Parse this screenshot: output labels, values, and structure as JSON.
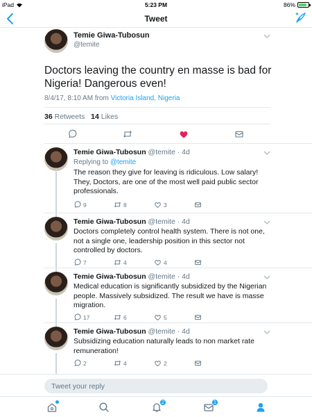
{
  "status_bar": {
    "device": "iPad",
    "time": "5:23 PM",
    "battery_percent": "86%",
    "battery_level": 0.86
  },
  "nav": {
    "title": "Tweet"
  },
  "main_tweet": {
    "name": "Temie Giwa-Tubosun",
    "handle": "@temite",
    "text": "Doctors leaving the country en masse is bad for Nigeria! Dangerous even!",
    "timestamp": "8/4/17, 8:10 AM from",
    "location": "Victoria Island, Nigeria",
    "retweets_count": "36",
    "retweets_label": "Retweets",
    "likes_count": "14",
    "likes_label": "Likes",
    "liked": true
  },
  "replies": [
    {
      "name": "Temie Giwa-Tubosun",
      "meta": "@temite · 4d",
      "replying_prefix": "Replying to",
      "replying_to": "@temite",
      "text": "The reason they give for leaving is ridiculous. Low salary! They, Doctors, are one of the most well paid public sector professionals.",
      "replies": "9",
      "retweets": "8",
      "likes": "3"
    },
    {
      "name": "Temie Giwa-Tubosun",
      "meta": "@temite · 4d",
      "text": "Doctors completely control health system. There is not one, not a single one, leadership position in this sector not controlled by doctors.",
      "replies": "7",
      "retweets": "4",
      "likes": "4"
    },
    {
      "name": "Temie Giwa-Tubosun",
      "meta": "@temite · 4d",
      "text": "Medical education is significantly subsidized by the Nigerian people. Massively subsidized. The result we have is masse migration.",
      "replies": "17",
      "retweets": "6",
      "likes": "5"
    },
    {
      "name": "Temie Giwa-Tubosun",
      "meta": "@temite · 4d",
      "text": "Subsidizing education naturally leads to non market rate remuneration!",
      "replies": "2",
      "retweets": "4",
      "likes": "2"
    }
  ],
  "reply_bar": {
    "placeholder": "Tweet your reply"
  },
  "tab_bar": {
    "notifications_badge": "2",
    "messages_badge": "1"
  },
  "colors": {
    "accent": "#1da1f2",
    "like": "#e0245e",
    "muted": "#657786"
  }
}
